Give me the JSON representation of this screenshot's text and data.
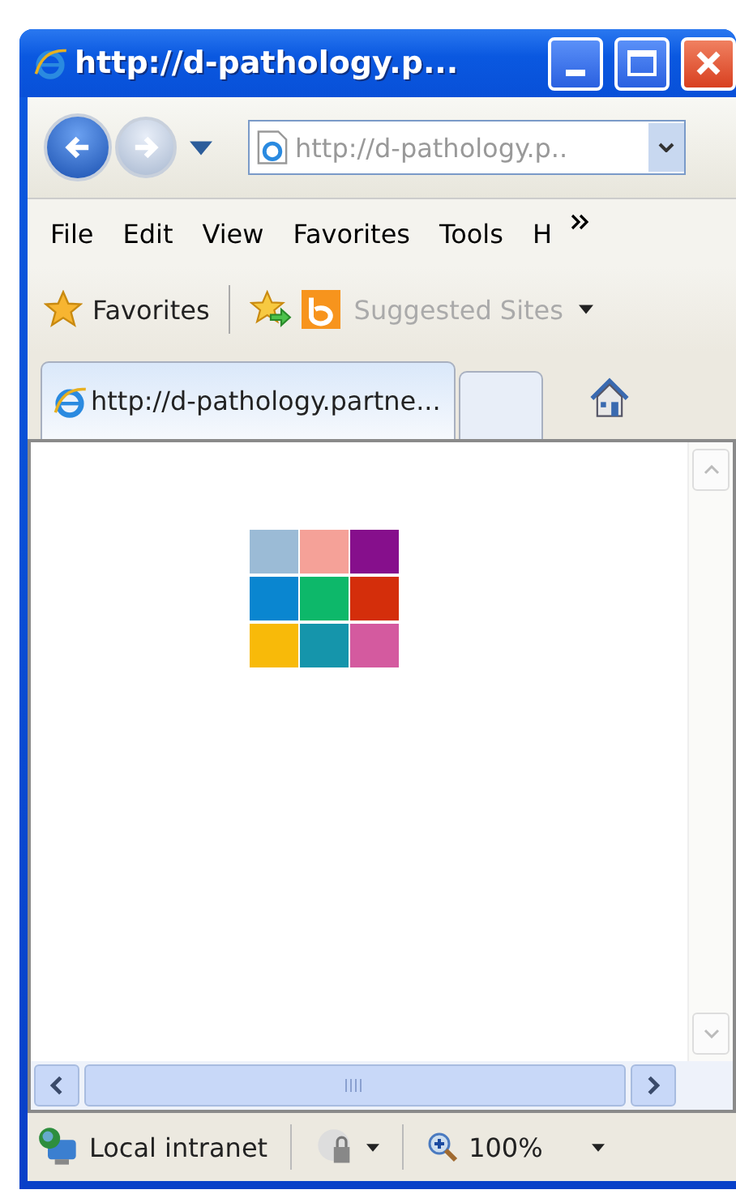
{
  "window": {
    "title": "http://d-pathology.p..."
  },
  "address_bar": {
    "value": "http://d-pathology.p.."
  },
  "menu": [
    {
      "label": "File"
    },
    {
      "label": "Edit"
    },
    {
      "label": "View"
    },
    {
      "label": "Favorites"
    },
    {
      "label": "Tools"
    },
    {
      "label": "H"
    }
  ],
  "favorites_bar": {
    "favorites": "Favorites",
    "suggested_sites": "Suggested Sites"
  },
  "tabs": [
    {
      "label": "http://d-pathology.partne...",
      "selected": true
    }
  ],
  "content": {
    "tiles": [
      {
        "color": "#9bbbd6"
      },
      {
        "color": "#f5a198"
      },
      {
        "color": "#860f8c"
      },
      {
        "color": "#0a86d0"
      },
      {
        "color": "#0db86a"
      },
      {
        "color": "#d42e0b"
      },
      {
        "color": "#f8ba09"
      },
      {
        "color": "#1595ab"
      },
      {
        "color": "#d45a9f"
      }
    ]
  },
  "status_bar": {
    "zone": "Local intranet",
    "zoom": "100%"
  }
}
